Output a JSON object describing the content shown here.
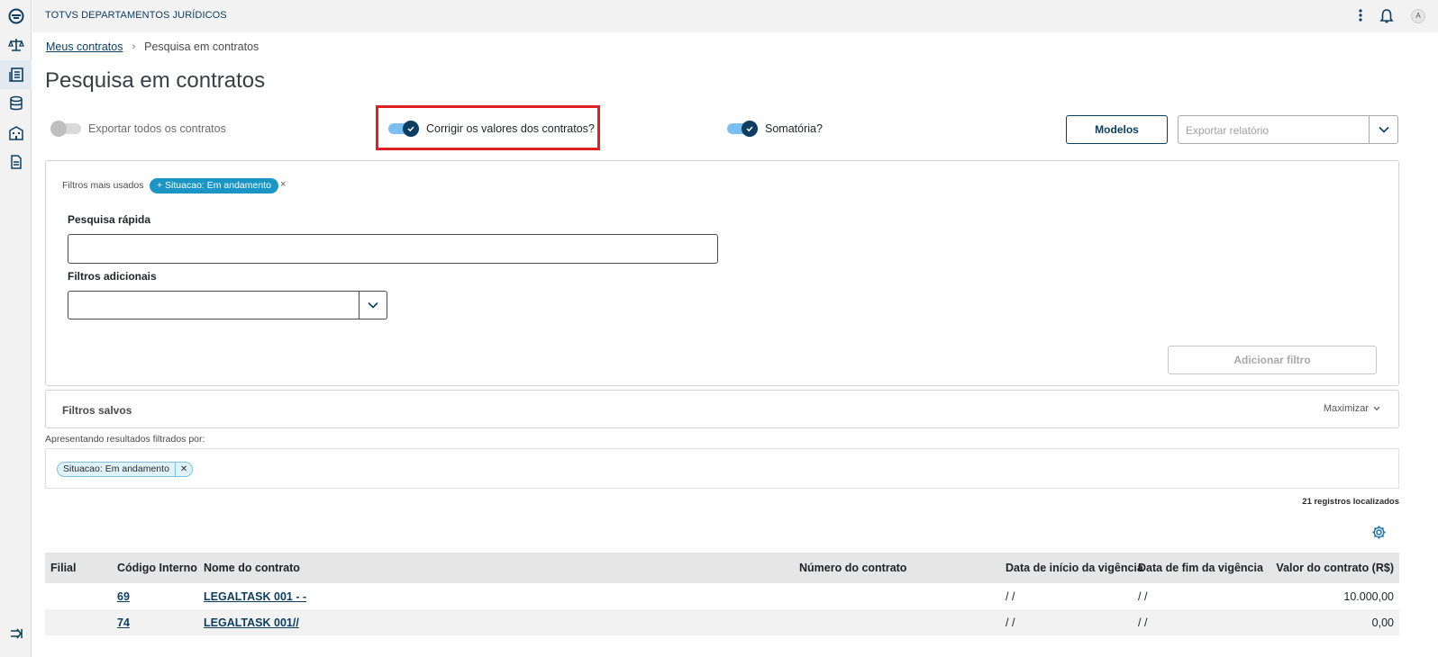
{
  "app": {
    "title": "TOTVS DEPARTAMENTOS JURÍDICOS",
    "avatar_initial": "A"
  },
  "breadcrumb": {
    "parent": "Meus contratos",
    "current": "Pesquisa em contratos"
  },
  "page": {
    "title": "Pesquisa em contratos"
  },
  "switches": {
    "export_all": {
      "label": "Exportar todos os contratos",
      "on": false
    },
    "correct_values": {
      "label": "Corrigir os valores dos contratos?",
      "on": true
    },
    "sum": {
      "label": "Somatória?",
      "on": true
    }
  },
  "toolbar": {
    "models_label": "Modelos",
    "export_placeholder": "Exportar relatório"
  },
  "filters": {
    "most_used_label": "Filtros mais usados",
    "most_used_chip": "+ Situacao: Em andamento",
    "quick_search_label": "Pesquisa rápida",
    "quick_search_value": "",
    "additional_label": "Filtros adicionais",
    "add_filter_label": "Adicionar filtro"
  },
  "saved_filters": {
    "title": "Filtros salvos",
    "maximize_label": "Maximizar"
  },
  "results": {
    "filtered_by_label": "Apresentando resultados filtrados por:",
    "active_chip": "Situacao: Em andamento",
    "count_text": "21 registros localizados"
  },
  "table": {
    "headers": {
      "filial": "Filial",
      "codigo": "Código Interno",
      "nome": "Nome do contrato",
      "numero": "Número do contrato",
      "inicio": "Data de início da vigência",
      "fim": "Data de fim da vigência",
      "valor": "Valor do contrato (R$)"
    },
    "rows": [
      {
        "filial": "",
        "codigo": "69",
        "nome": "LEGALTASK 001 - -",
        "numero": "",
        "inicio": "/ /",
        "fim": "/ /",
        "valor": "10.000,00"
      },
      {
        "filial": "",
        "codigo": "74",
        "nome": "LEGALTASK 001//",
        "numero": "",
        "inicio": "/ /",
        "fim": "/ /",
        "valor": "0,00"
      }
    ]
  },
  "colors": {
    "primary": "#0c3e62",
    "accent": "#1b95c4",
    "highlight": "#e02020"
  }
}
